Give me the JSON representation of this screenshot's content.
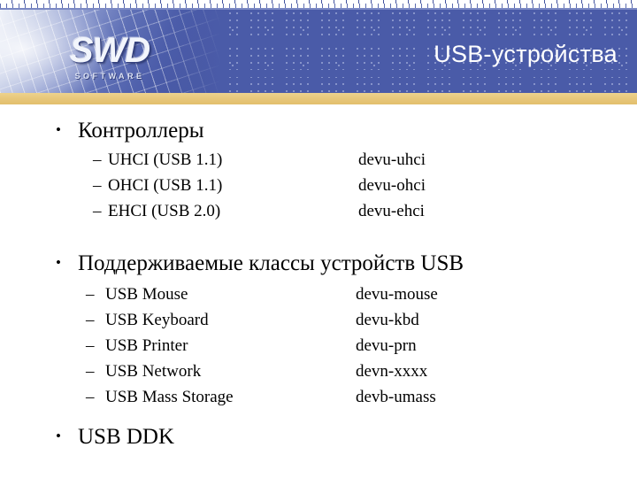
{
  "header": {
    "title": "USB-устройства",
    "logo_mark": "SWD",
    "logo_sub": "SOFTWARE",
    "blue": "#4a5ba8",
    "gold": "#e8c87c"
  },
  "content": {
    "bullet_glyph": "•",
    "dash_glyph": "–",
    "sections": [
      {
        "heading": "Контроллеры",
        "rows": [
          {
            "label": "UHCI (USB 1.1)",
            "value": "devu-uhci"
          },
          {
            "label": "OHCI (USB 1.1)",
            "value": "devu-ohci"
          },
          {
            "label": "EHCI (USB 2.0)",
            "value": "devu-ehci"
          }
        ]
      },
      {
        "heading": "Поддерживаемые классы устройств USB",
        "rows": [
          {
            "label": "USB Mouse",
            "value": "devu-mouse"
          },
          {
            "label": "USB Keyboard",
            "value": "devu-kbd"
          },
          {
            "label": "USB Printer",
            "value": "devu-prn"
          },
          {
            "label": "USB Network",
            "value": "devn-xxxx"
          },
          {
            "label": "USB Mass Storage",
            "value": "devb-umass"
          }
        ]
      },
      {
        "heading": "USB DDK",
        "rows": []
      }
    ]
  }
}
